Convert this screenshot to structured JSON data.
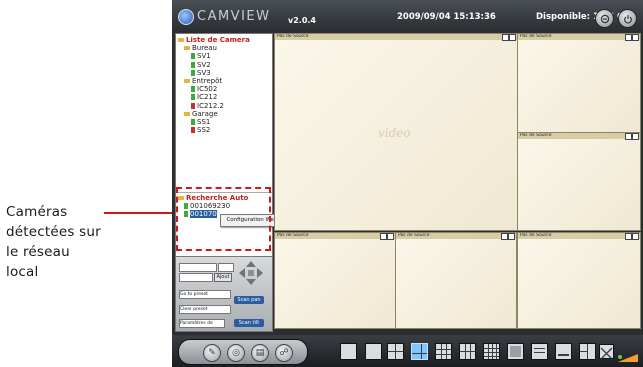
{
  "annotation": {
    "lines": [
      "Caméras",
      "détectées sur",
      "le réseau",
      "local"
    ],
    "accent": "#d01818"
  },
  "topbar": {
    "brand": "CAMVIEW",
    "version": "v2.0.4",
    "datetime": "2009/09/04 15:13:36",
    "disk": "Disponible: 14,6 GB",
    "icons": [
      "camera-logo-icon",
      "minimize-icon",
      "power-icon"
    ]
  },
  "camera_list": {
    "title": "Liste de Camera",
    "groups": [
      {
        "name": "Bureau",
        "cams": [
          {
            "name": "SV1",
            "status": "green"
          },
          {
            "name": "SV2",
            "status": "green"
          },
          {
            "name": "SV3",
            "status": "green"
          }
        ]
      },
      {
        "name": "Entrepôt",
        "cams": [
          {
            "name": "IC502",
            "status": "green"
          },
          {
            "name": "IC212",
            "status": "green"
          },
          {
            "name": "IC212.2",
            "status": "red"
          }
        ]
      },
      {
        "name": "Garage",
        "cams": [
          {
            "name": "SS1",
            "status": "green"
          },
          {
            "name": "SS2",
            "status": "red"
          }
        ]
      }
    ]
  },
  "auto_search": {
    "title": "Recherche Auto",
    "items": [
      "001069230",
      "001070"
    ],
    "context_menu": "Configuration Web"
  },
  "ptz": {
    "add": "Ajout",
    "goto_preset": "Go to preset",
    "clear_preset": "Clear preset",
    "scan_pan": "Scan pan",
    "scan_tilt": "Scan tilt",
    "params": "Paramètres de"
  },
  "views": {
    "no_source": "Pas de Source",
    "watermark": "video"
  },
  "bottom": {
    "tools": [
      "settings-wrench-icon",
      "disc-icon",
      "schedule-icon",
      "cameras-icon"
    ],
    "layouts": [
      "layout-1",
      "layout-4",
      "layout-6",
      "layout-9",
      "layout-13",
      "layout-16",
      "layout-8",
      "layout-10",
      "layout-7",
      "layout-9b",
      "fullscreen"
    ],
    "selected_layout": "layout-6"
  }
}
